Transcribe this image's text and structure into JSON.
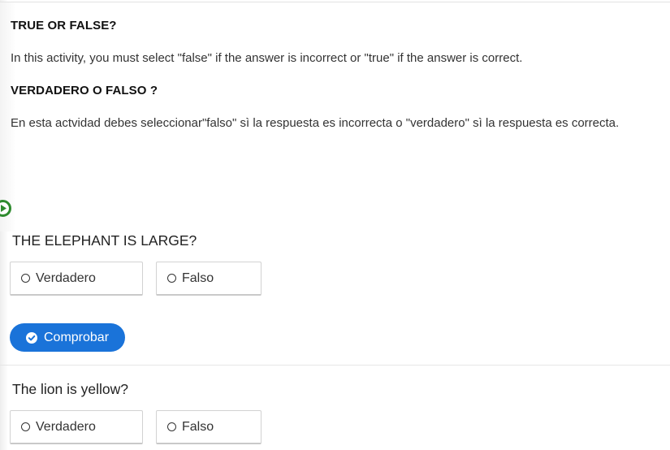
{
  "intro": {
    "en_title": "TRUE OR FALSE?",
    "en_text": "In this activity, you must select \"false\" if the answer is incorrect or \"true\" if the answer is correct.",
    "es_title": "VERDADERO O FALSO ?",
    "es_text": "En esta actvidad debes seleccionar\"falso\" sì la respuesta es incorrecta o \"verdadero\" sì la respuesta es correcta."
  },
  "questions": [
    {
      "text": "THE ELEPHANT IS LARGE?",
      "true_label": "Verdadero",
      "false_label": "Falso"
    },
    {
      "text": "The lion is yellow?",
      "true_label": "Verdadero",
      "false_label": "Falso"
    }
  ],
  "check_button": {
    "label": "Comprobar"
  },
  "colors": {
    "accent": "#1a73d9",
    "play": "#2e8b2e"
  },
  "icons": [
    "play-icon",
    "check-circle-icon",
    "radio-icon"
  ]
}
